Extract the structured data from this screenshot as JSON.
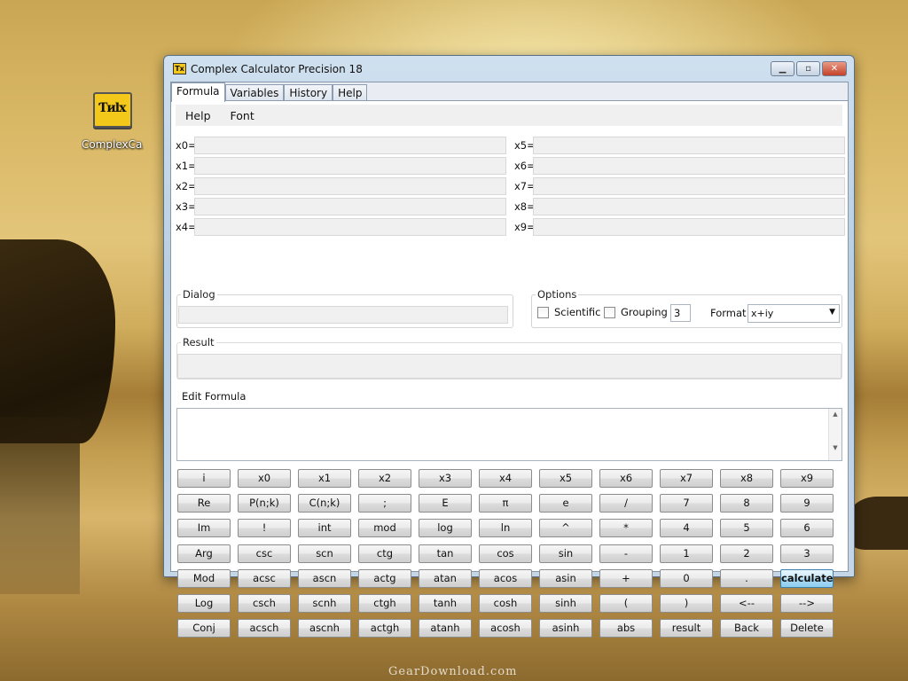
{
  "desktop": {
    "icon_label": "ComplexCa...",
    "watermark": "GearDownload.com"
  },
  "window": {
    "title": "Complex Calculator Precision 18",
    "tabs": [
      "Formula",
      "Variables",
      "History",
      "Help"
    ],
    "active_tab": "Formula"
  },
  "menu": {
    "items": [
      "Help",
      "Font"
    ]
  },
  "variables": {
    "left": [
      "x0=",
      "x1=",
      "x2=",
      "x3=",
      "x4="
    ],
    "right": [
      "x5=",
      "x6=",
      "x7=",
      "x8=",
      "x9="
    ]
  },
  "dialog": {
    "title": "Dialog",
    "value": ""
  },
  "options": {
    "title": "Options",
    "scientific_label": "Scientific",
    "scientific_checked": false,
    "grouping_label": "Grouping",
    "grouping_checked": false,
    "grouping_value": "3",
    "format_label": "Format",
    "format_value": "x+iy"
  },
  "result": {
    "title": "Result",
    "value": ""
  },
  "edit_formula": {
    "title": "Edit Formula",
    "value": ""
  },
  "keypad": [
    [
      "i",
      "x0",
      "x1",
      "x2",
      "x3",
      "x4",
      "x5",
      "x6",
      "x7",
      "x8",
      "x9"
    ],
    [
      "Re",
      "P(n;k)",
      "C(n;k)",
      ";",
      "E",
      "π",
      "e",
      "/",
      "7",
      "8",
      "9"
    ],
    [
      "Im",
      "!",
      "int",
      "mod",
      "log",
      "ln",
      "^",
      "*",
      "4",
      "5",
      "6"
    ],
    [
      "Arg",
      "csc",
      "scn",
      "ctg",
      "tan",
      "cos",
      "sin",
      "-",
      "1",
      "2",
      "3"
    ],
    [
      "Mod",
      "acsc",
      "ascn",
      "actg",
      "atan",
      "acos",
      "asin",
      "+",
      "0",
      ".",
      "calculate"
    ],
    [
      "Log",
      "csch",
      "scnh",
      "ctgh",
      "tanh",
      "cosh",
      "sinh",
      "(",
      ")",
      "<--",
      "-->"
    ],
    [
      "Conj",
      "acsch",
      "ascnh",
      "actgh",
      "atanh",
      "acosh",
      "asinh",
      "abs",
      "result",
      "Back",
      "Delete"
    ]
  ],
  "colors": {
    "accent_button": "#a9dbf5",
    "window_frame": "#b9cfe2"
  }
}
